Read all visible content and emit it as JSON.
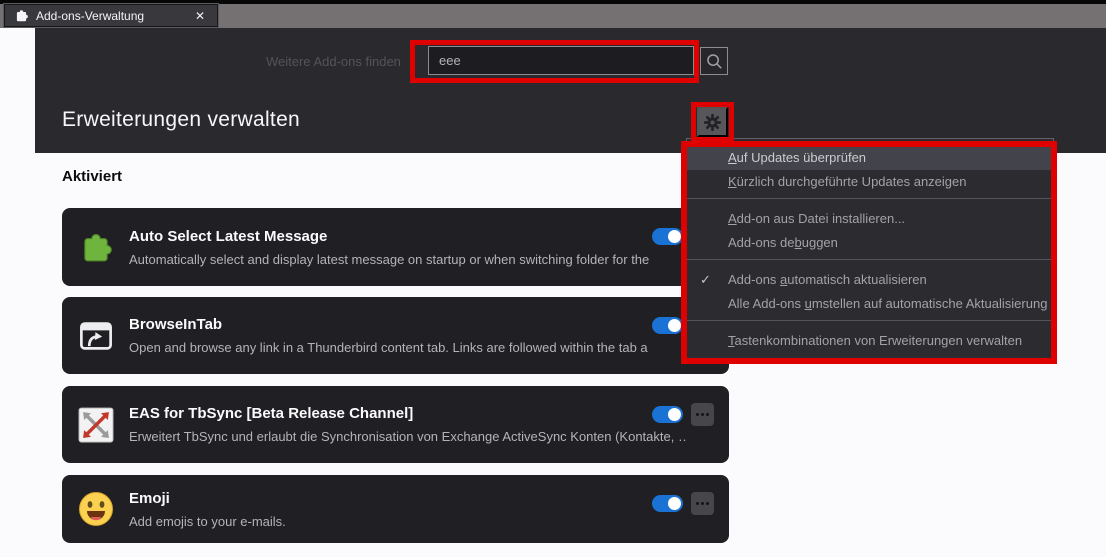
{
  "window": {
    "tab_title": "Add-ons-Verwaltung",
    "close_glyph": "✕"
  },
  "header": {
    "search_label": "Weitere Add-ons finden",
    "search_value": "eee",
    "title": "Erweiterungen verwalten"
  },
  "section": {
    "enabled_heading": "Aktiviert"
  },
  "menu": {
    "check_glyph": "✓",
    "items": [
      {
        "pre": "",
        "key": "A",
        "post": "uf Updates überprüfen",
        "highlighted": true,
        "checked": false
      },
      {
        "pre": "",
        "key": "K",
        "post": "ürzlich durchgeführte Updates anzeigen",
        "highlighted": false,
        "checked": false
      },
      {
        "pre": "",
        "key": "A",
        "post": "dd-on aus Datei installieren...",
        "highlighted": false,
        "checked": false
      },
      {
        "pre": "Add-ons de",
        "key": "b",
        "post": "uggen",
        "highlighted": false,
        "checked": false
      },
      {
        "pre": "Add-ons ",
        "key": "a",
        "post": "utomatisch aktualisieren",
        "highlighted": false,
        "checked": true
      },
      {
        "pre": "Alle Add-ons ",
        "key": "u",
        "post": "mstellen auf automatische Aktualisierung",
        "highlighted": false,
        "checked": false
      },
      {
        "pre": "",
        "key": "T",
        "post": "astenkombinationen von Erweiterungen verwalten",
        "highlighted": false,
        "checked": false
      }
    ]
  },
  "addons": [
    {
      "name": "Auto Select Latest Message",
      "description": "Automatically select and display latest message on startup or when switching folder for the",
      "icon": "green-puzzle-icon",
      "enabled": true
    },
    {
      "name": "BrowseInTab",
      "description": "Open and browse any link in a Thunderbird content tab. Links are followed within the tab a",
      "icon": "window-arrow-icon",
      "enabled": true
    },
    {
      "name": "EAS for TbSync [Beta Release Channel]",
      "description": "Erweitert TbSync und erlaubt die Synchronisation von Exchange ActiveSync Konten (Kontakte, …",
      "icon": "sync-arrows-icon",
      "enabled": true
    },
    {
      "name": "Emoji",
      "description": "Add emojis to your e-mails.",
      "icon": "emoji-face-icon",
      "enabled": true
    }
  ],
  "colors": {
    "annotation_red": "#df0000",
    "toggle_blue": "#1a73d4",
    "header_bg": "#2a2a2e",
    "card_bg": "#202024",
    "tabbar_gray": "#757072"
  }
}
